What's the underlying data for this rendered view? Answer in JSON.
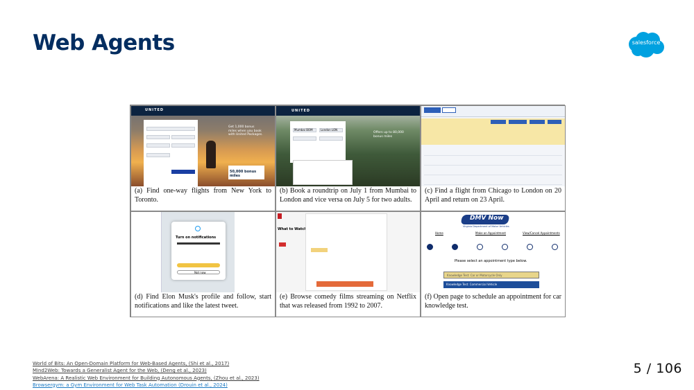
{
  "slide": {
    "title": "Web Agents",
    "logo_text": "salesforce",
    "page_number": "5 / 106"
  },
  "colors": {
    "title": "#032D60",
    "logo": "#00A1E0",
    "link_blue": "#1a78c2"
  },
  "figure": {
    "panels": [
      {
        "id": "a",
        "caption": "(a) Find one-way flights from New York to Toronto.",
        "shot_text": [
          "UNITED",
          "Get 1,000 bonus miles when you book with United Packages.",
          "50,000 bonus miles"
        ]
      },
      {
        "id": "b",
        "caption": "(b) Book a roundtrip on July 1 from Mumbai to London and vice versa on July 5 for two adults.",
        "shot_text": [
          "UNITED",
          "Mumbai BOM",
          "London LON",
          "Offers up to 80,000 bonus miles"
        ]
      },
      {
        "id": "c",
        "caption": "(c) Find a flight from Chicago to London on 20 April and return on 23 April.",
        "shot_text": []
      },
      {
        "id": "d",
        "caption": "(d) Find Elon Musk's profile and follow, start notifications and like the latest tweet.",
        "shot_text": [
          "Turn on notifications",
          "Not now"
        ]
      },
      {
        "id": "e",
        "caption": "(e) Browse comedy films streaming on Netflix that was released from 1992 to 2007.",
        "shot_text": [
          "What to Watch"
        ]
      },
      {
        "id": "f",
        "caption": "(f) Open page to schedule an appointment for car knowledge test.",
        "shot_text": [
          "DMV Now",
          "Virginia Department of Motor Vehicles",
          "Home",
          "Make an Appointment",
          "View/Cancel Appointments",
          "Please select an appointment type below.",
          "Knowledge Test: Car or Motorcycle Only",
          "Knowledge Test: Commercial Vehicle"
        ]
      }
    ]
  },
  "references": [
    {
      "text": "World of Bits: An Open-Domain Platform for Web-Based Agents, (Shi et al., 2017)"
    },
    {
      "text": "Mind2Web: Towards a Generalist Agent for the Web, (Deng et al., 2023)"
    },
    {
      "text": "WebArena: A Realistic Web Environment for Building Autonomous Agents, (Zhou et al., 2023)"
    },
    {
      "text": "Browsergym: a Gym Environment for Web Task Automation (Drouin et al., 2024)"
    }
  ]
}
